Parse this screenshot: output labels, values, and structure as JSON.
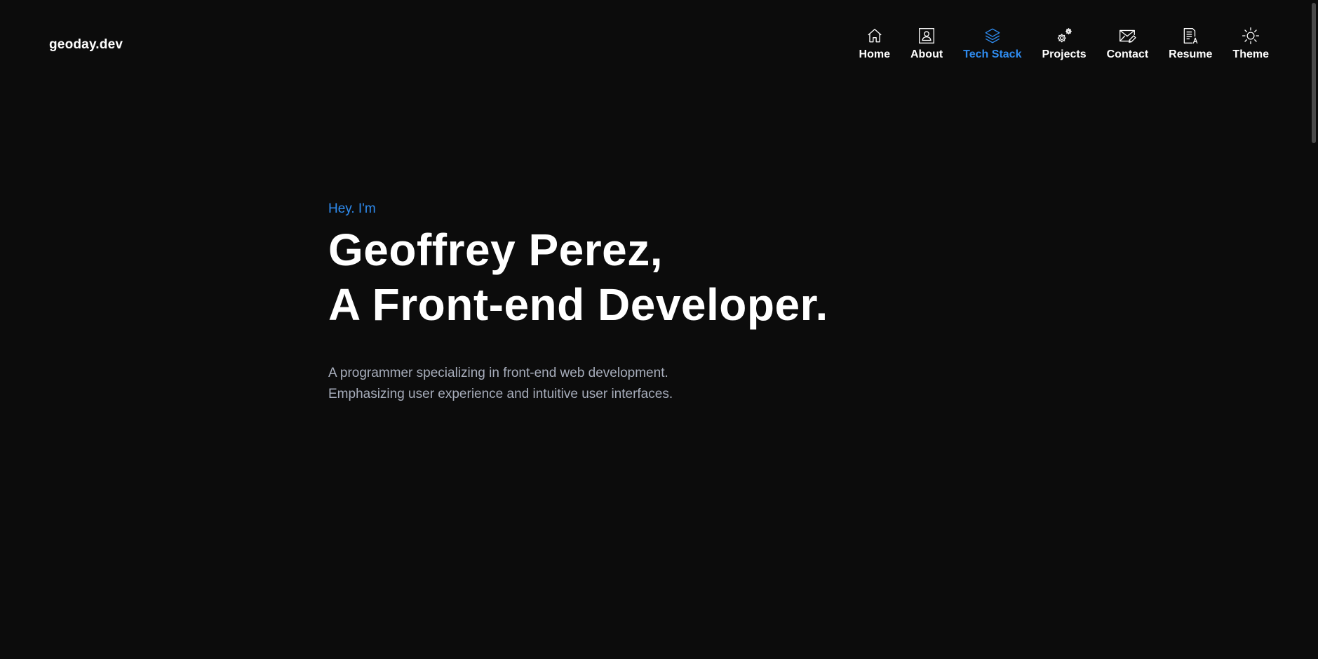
{
  "brand": {
    "logo_text": "geoday.dev",
    "accent_color": "#2f8cf0",
    "background_color": "#0c0c0c"
  },
  "nav": {
    "items": [
      {
        "label": "Home",
        "icon": "home-icon",
        "active": false
      },
      {
        "label": "About",
        "icon": "user-card-icon",
        "active": false
      },
      {
        "label": "Tech Stack",
        "icon": "layers-icon",
        "active": true
      },
      {
        "label": "Projects",
        "icon": "gears-icon",
        "active": false
      },
      {
        "label": "Contact",
        "icon": "mail-icon",
        "active": false
      },
      {
        "label": "Resume",
        "icon": "document-icon",
        "active": false
      },
      {
        "label": "Theme",
        "icon": "sun-icon",
        "active": false
      }
    ]
  },
  "hero": {
    "greeting": "Hey. I'm",
    "headline_line1": "Geoffrey Perez,",
    "headline_line2": "A Front-end Developer.",
    "description_line1": "A programmer specializing in front-end web development.",
    "description_line2": "Emphasizing user experience and intuitive user interfaces."
  }
}
